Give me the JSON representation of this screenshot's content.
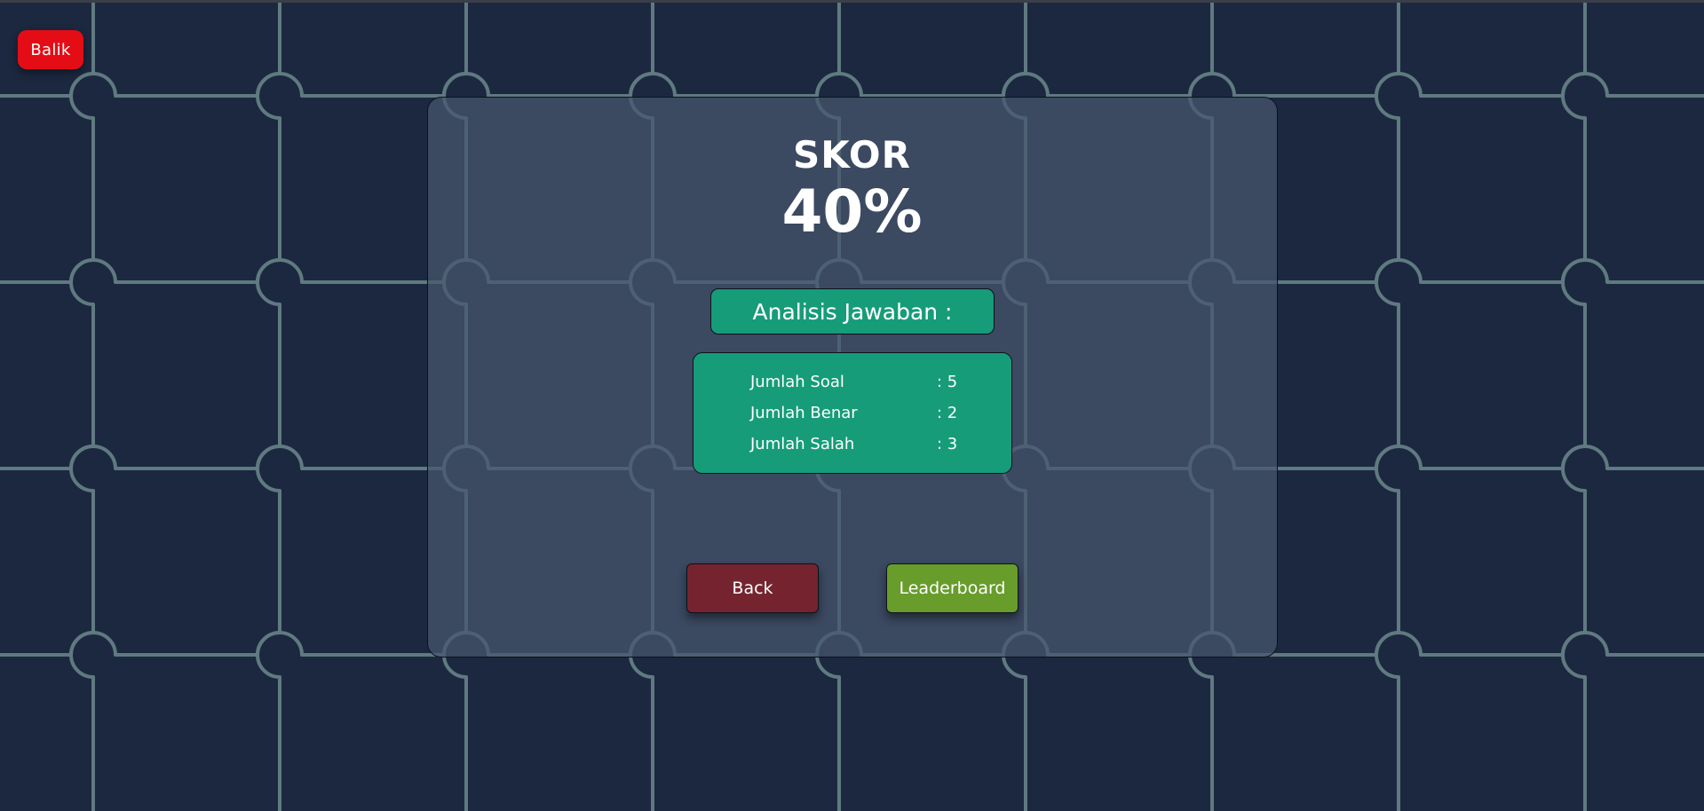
{
  "nav": {
    "back_chip_label": "Balik"
  },
  "score": {
    "label": "SKOR",
    "value": "40%"
  },
  "analysis": {
    "title": "Analisis Jawaban :",
    "rows": [
      {
        "label": "Jumlah Soal",
        "value": ": 5"
      },
      {
        "label": "Jumlah Benar",
        "value": ": 2"
      },
      {
        "label": "Jumlah Salah",
        "value": ": 3"
      }
    ]
  },
  "actions": {
    "back_label": "Back",
    "leaderboard_label": "Leaderboard"
  },
  "colors": {
    "background": "#1c2840",
    "puzzle_lines": "#5f7a80",
    "chip_red": "#e40d16",
    "panel": "#48566e",
    "analysis_green": "#169c79",
    "back_button": "#75242f",
    "leaderboard_button": "#689c2b"
  },
  "background_pattern": "jigsaw-puzzle-pattern"
}
